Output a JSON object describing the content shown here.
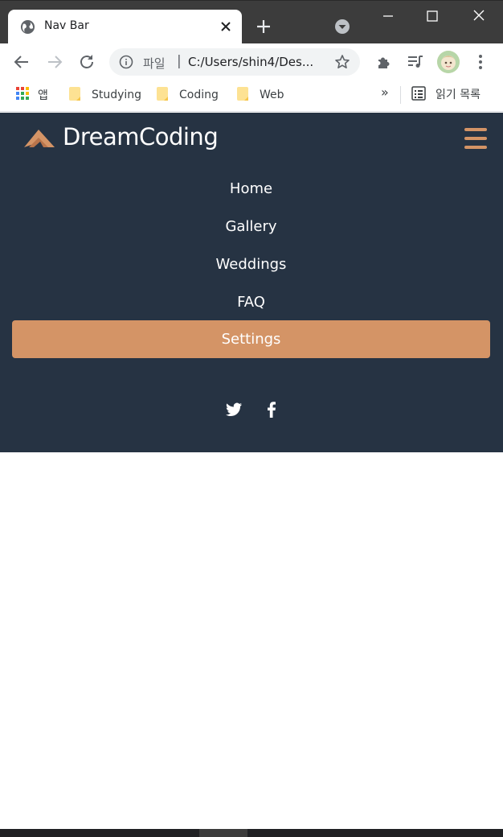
{
  "browser": {
    "tab_title": "Nav Bar",
    "omnibox": {
      "scheme_label": "파일",
      "separator": "|",
      "url": "C:/Users/shin4/Des..."
    },
    "bookmarks": {
      "apps_label": "앱",
      "folders": [
        "Studying",
        "Coding",
        "Web"
      ],
      "more": "»",
      "reading_list": "읽기 목록"
    },
    "icons": [
      "globe-icon",
      "close-icon",
      "plus-icon",
      "tab-search-icon",
      "minimize-icon",
      "maximize-icon",
      "window-close-icon",
      "back-arrow-icon",
      "forward-arrow-icon",
      "reload-icon",
      "info-icon",
      "star-icon",
      "extensions-puzzle-icon",
      "media-playlist-icon",
      "avatar",
      "kebab-menu-icon",
      "apps-grid-icon",
      "folder-icon",
      "reading-list-icon"
    ]
  },
  "page": {
    "logo_text": "DreamCoding",
    "menu": [
      "Home",
      "Gallery",
      "Weddings",
      "FAQ",
      "Settings"
    ],
    "active_menu": "Settings",
    "social_icons": [
      "twitter-icon",
      "facebook-icon"
    ],
    "colors": {
      "navbar_bg": "#263343",
      "accent": "#d49466",
      "text": "#ffffff"
    }
  }
}
